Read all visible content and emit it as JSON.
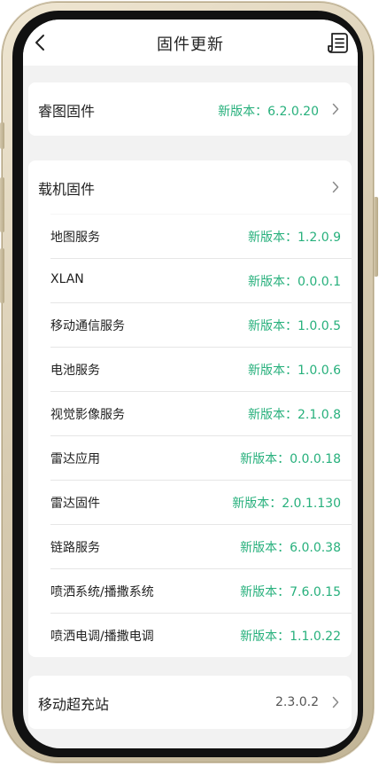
{
  "header": {
    "title": "固件更新",
    "back_icon": "chevron-left-icon",
    "log_icon": "document-list-icon"
  },
  "ruitu_firmware": {
    "title": "睿图固件",
    "version": "新版本：6.2.0.20"
  },
  "carrier_firmware": {
    "title": "载机固件",
    "items": [
      {
        "label": "地图服务",
        "version": "新版本：1.2.0.9"
      },
      {
        "label": "XLAN",
        "version": "新版本：0.0.0.1"
      },
      {
        "label": "移动通信服务",
        "version": "新版本：1.0.0.5"
      },
      {
        "label": "电池服务",
        "version": "新版本：1.0.0.6"
      },
      {
        "label": "视觉影像服务",
        "version": "新版本：2.1.0.8"
      },
      {
        "label": "雷达应用",
        "version": "新版本：0.0.0.18"
      },
      {
        "label": "雷达固件",
        "version": "新版本：2.0.1.130"
      },
      {
        "label": "链路服务",
        "version": "新版本：6.0.0.38"
      },
      {
        "label": "喷洒系统/播撒系统",
        "version": "新版本：7.6.0.15"
      },
      {
        "label": "喷洒电调/播撒电调",
        "version": "新版本：1.1.0.22"
      }
    ]
  },
  "charging_station": {
    "title": "移动超充站",
    "version": "2.3.0.2"
  },
  "colors": {
    "accent_green": "#27b07c",
    "background": "#f2f2f2",
    "card": "#ffffff"
  }
}
